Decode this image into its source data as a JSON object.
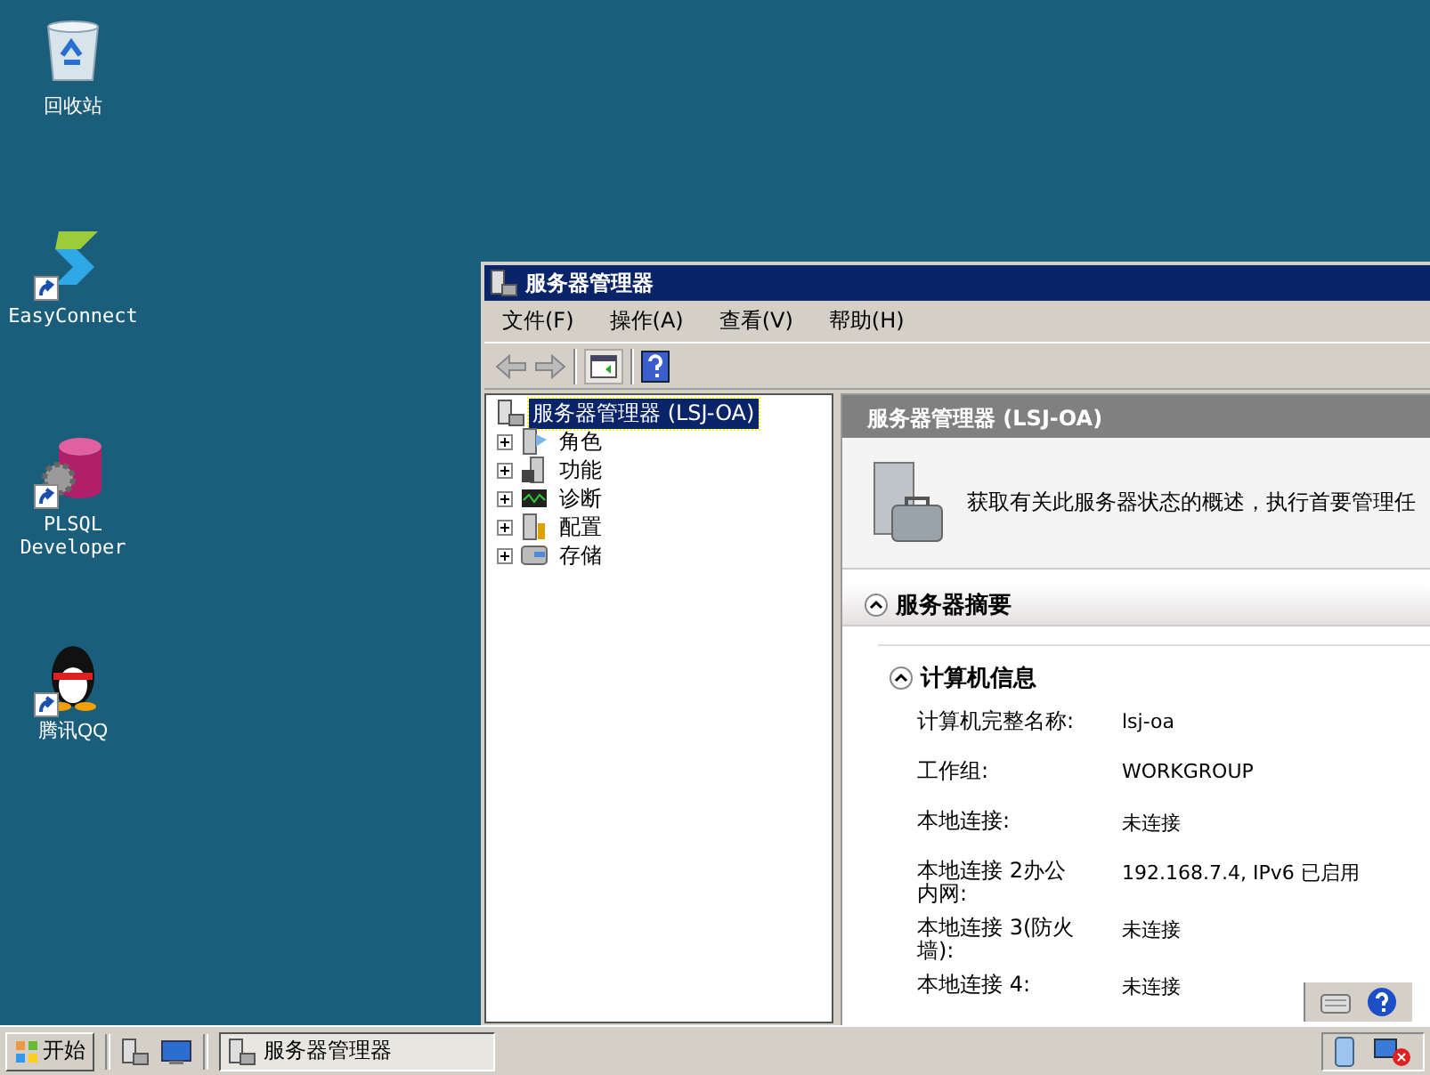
{
  "desktop_icons": [
    {
      "kind": "recycle",
      "label": "回收站",
      "shortcut": false
    },
    {
      "kind": "connect",
      "label": "EasyConnect",
      "shortcut": true
    },
    {
      "kind": "database",
      "label": "PLSQL Developer",
      "shortcut": true
    },
    {
      "kind": "penguin",
      "label": "腾讯QQ",
      "shortcut": true
    }
  ],
  "window": {
    "title": "服务器管理器",
    "menu": [
      "文件(F)",
      "操作(A)",
      "查看(V)",
      "帮助(H)"
    ],
    "tree": {
      "label": "服务器管理器 (LSJ-OA)",
      "selected": true,
      "children": [
        {
          "label": "角色",
          "kind": "roles",
          "expanded": false
        },
        {
          "label": "功能",
          "kind": "features",
          "expanded": false
        },
        {
          "label": "诊断",
          "kind": "diagnostics",
          "expanded": false
        },
        {
          "label": "配置",
          "kind": "config",
          "expanded": false
        },
        {
          "label": "存储",
          "kind": "storage",
          "expanded": false
        }
      ]
    },
    "pane_title": "服务器管理器 (LSJ-OA)",
    "description": "获取有关此服务器状态的概述，执行首要管理任",
    "section": {
      "title": "服务器摘要",
      "expanded": true,
      "subsection": {
        "title": "计算机信息",
        "expanded": true,
        "rows": [
          {
            "label": "计算机完整名称:",
            "value": "lsj-oa"
          },
          {
            "label": "工作组:",
            "value": "WORKGROUP"
          },
          {
            "label": "本地连接:",
            "value": "未连接"
          },
          {
            "label": "本地连接 2办公内网:",
            "value": "192.168.7.4, IPv6 已启用"
          },
          {
            "label": "本地连接 3(防火墙):",
            "value": "未连接"
          },
          {
            "label": "本地连接 4:",
            "value": "未连接"
          }
        ]
      }
    }
  },
  "taskbar": {
    "start": "开始",
    "tasks": [
      {
        "label": "服务器管理器",
        "selected": true
      }
    ]
  }
}
